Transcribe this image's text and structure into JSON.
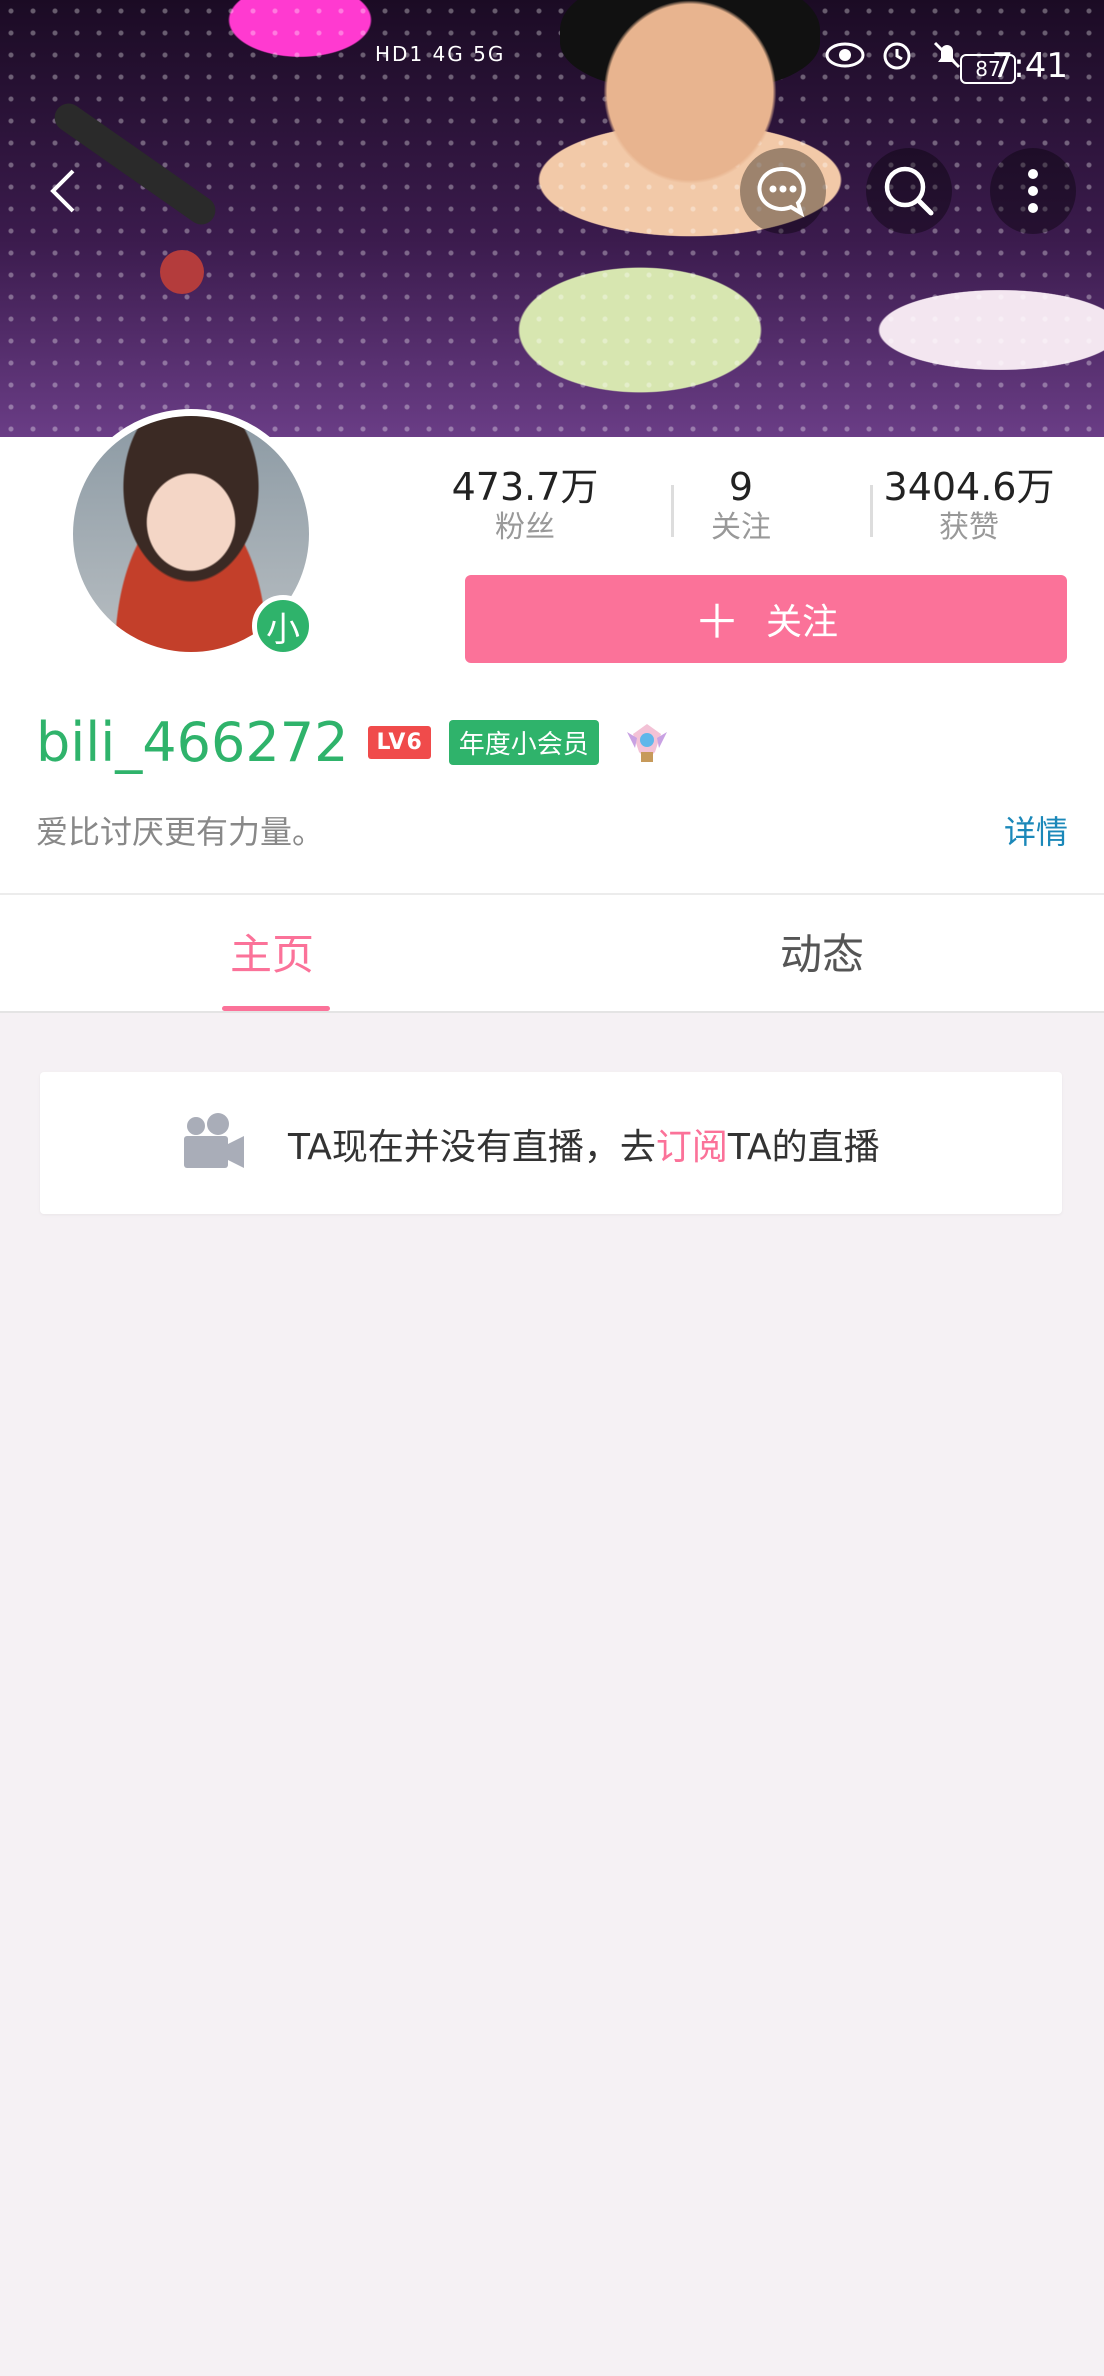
{
  "status_bar": {
    "left_indicators": "HD1 4G 5G",
    "battery": "87",
    "time": "7:41"
  },
  "header": {
    "back_icon": "chevron-left-icon",
    "message_icon": "message-bubble-icon",
    "search_icon": "search-icon",
    "more_icon": "more-vertical-icon"
  },
  "profile": {
    "avatar_badge": "小",
    "stats": [
      {
        "value": "473.7万",
        "label": "粉丝"
      },
      {
        "value": "9",
        "label": "关注"
      },
      {
        "value": "3404.6万",
        "label": "获赞"
      }
    ],
    "follow_label": "关注",
    "username": "bili_466272",
    "level": "LV6",
    "vip_label": "年度小会员",
    "signature": "爱比讨厌更有力量。",
    "details_label": "详情"
  },
  "tabs": [
    {
      "label": "主页",
      "active": true
    },
    {
      "label": "动态",
      "active": false
    }
  ],
  "live_card": {
    "prefix": "TA现在并没有直播，去",
    "link": "订阅",
    "suffix": "TA的直播"
  },
  "colors": {
    "accent_pink": "#fb7299",
    "name_green": "#2fb36b",
    "link_blue": "#1b88b9"
  }
}
